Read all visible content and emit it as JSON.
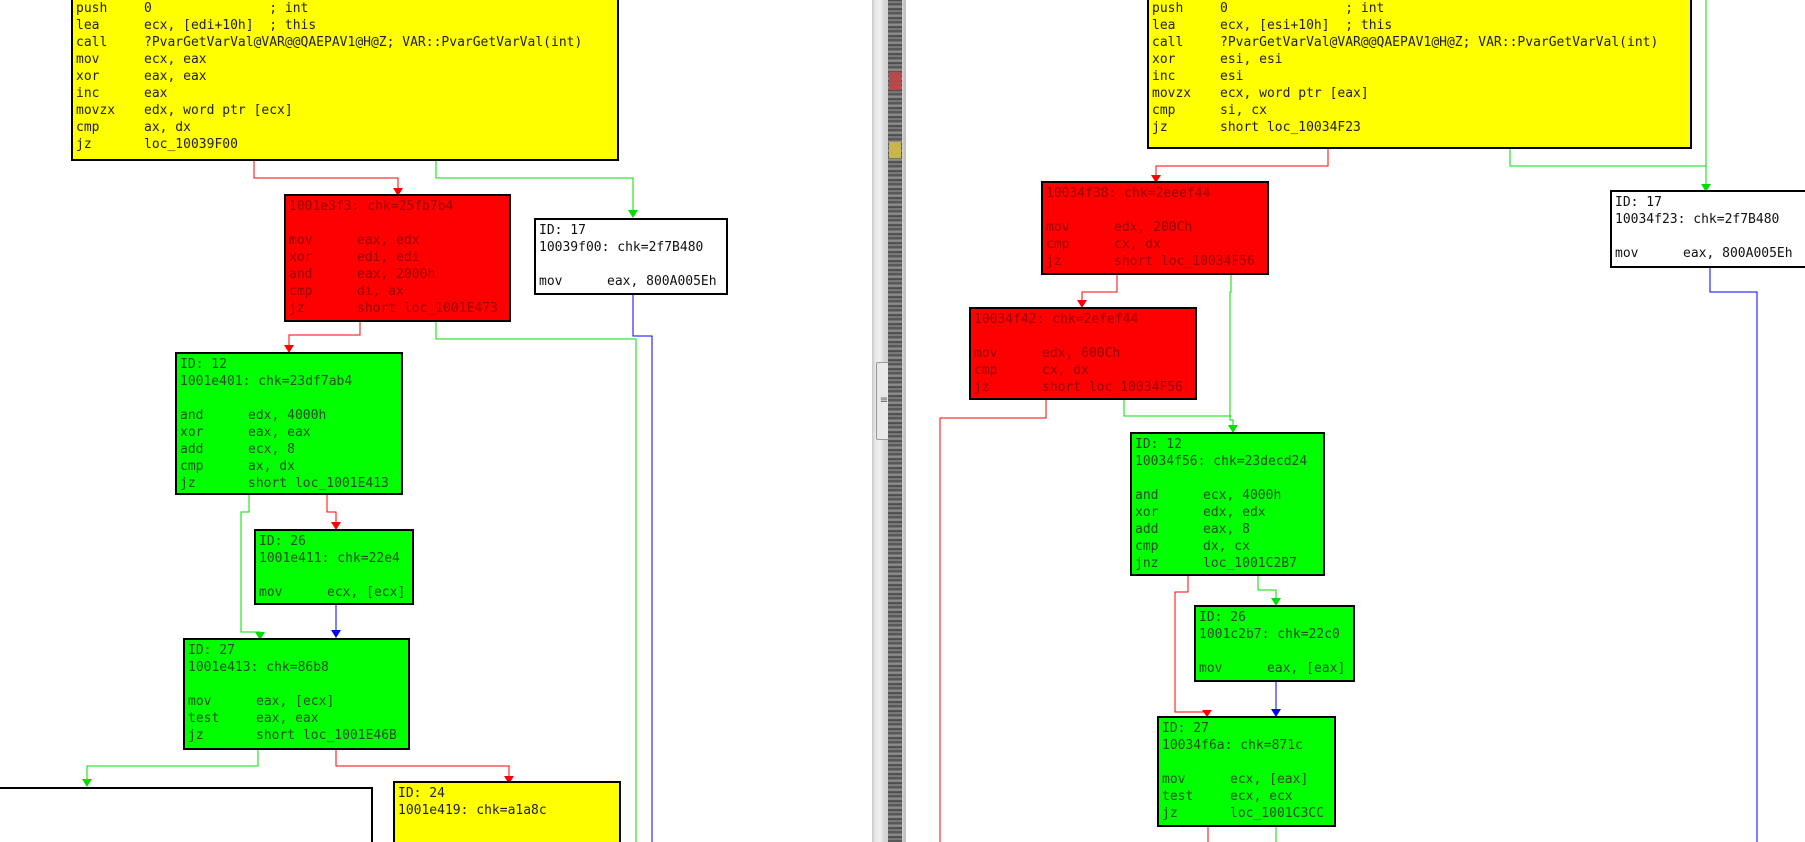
{
  "left_pane": {
    "nodes": [
      {
        "name": "block-left-top",
        "color": "yellow",
        "header": [],
        "instructions": [
          [
            "push",
            "0               ; int"
          ],
          [
            "lea",
            "ecx, [edi+10h]  ; this"
          ],
          [
            "call",
            "?PvarGetVarVal@VAR@@QAEPAV1@H@Z; VAR::PvarGetVarVal(int)"
          ],
          [
            "mov",
            "ecx, eax"
          ],
          [
            "xor",
            "eax, eax"
          ],
          [
            "inc",
            "eax"
          ],
          [
            "movzx",
            "edx, word ptr [ecx]"
          ],
          [
            "cmp",
            "ax, dx"
          ],
          [
            "jz",
            "loc_10039F00"
          ]
        ]
      },
      {
        "name": "block-left-1001e3f3",
        "color": "red",
        "header": [
          "1001e3f3: chk=25fb7b4"
        ],
        "instructions": [
          [
            "mov",
            "eax, edx"
          ],
          [
            "xor",
            "edi, edi"
          ],
          [
            "and",
            "eax, 2000h"
          ],
          [
            "cmp",
            "di, ax"
          ],
          [
            "jz",
            "short loc_1001E473"
          ]
        ]
      },
      {
        "name": "block-left-10039f00",
        "color": "white",
        "header": [
          "ID: 17",
          "10039f00: chk=2f7B480"
        ],
        "instructions": [
          [
            "mov",
            "eax, 800A005Eh"
          ]
        ]
      },
      {
        "name": "block-left-1001e401",
        "color": "green",
        "header": [
          "ID: 12",
          "1001e401: chk=23df7ab4"
        ],
        "instructions": [
          [
            "and",
            "edx, 4000h"
          ],
          [
            "xor",
            "eax, eax"
          ],
          [
            "add",
            "ecx, 8"
          ],
          [
            "cmp",
            "ax, dx"
          ],
          [
            "jz",
            "short loc_1001E413"
          ]
        ]
      },
      {
        "name": "block-left-1001e411",
        "color": "green",
        "header": [
          "ID: 26",
          "1001e411: chk=22e4"
        ],
        "instructions": [
          [
            "mov",
            "ecx, [ecx]"
          ]
        ]
      },
      {
        "name": "block-left-1001e413",
        "color": "green",
        "header": [
          "ID: 27",
          "1001e413: chk=86b8"
        ],
        "instructions": [
          [
            "mov",
            "eax, [ecx]"
          ],
          [
            "test",
            "eax, eax"
          ],
          [
            "jz",
            "short loc_1001E46B"
          ]
        ]
      },
      {
        "name": "block-left-bottom-white",
        "color": "white",
        "header": [],
        "instructions": []
      },
      {
        "name": "block-left-1001e419",
        "color": "yellow",
        "header": [
          "ID: 24",
          "1001e419: chk=a1a8c"
        ],
        "instructions": []
      }
    ]
  },
  "right_pane": {
    "nodes": [
      {
        "name": "block-right-top",
        "color": "yellow",
        "header": [],
        "instructions": [
          [
            "push",
            "0               ; int"
          ],
          [
            "lea",
            "ecx, [esi+10h]  ; this"
          ],
          [
            "call",
            "?PvarGetVarVal@VAR@@QAEPAV1@H@Z; VAR::PvarGetVarVal(int)"
          ],
          [
            "xor",
            "esi, esi"
          ],
          [
            "inc",
            "esi"
          ],
          [
            "movzx",
            "ecx, word ptr [eax]"
          ],
          [
            "cmp",
            "si, cx"
          ],
          [
            "jz",
            "short loc_10034F23"
          ]
        ]
      },
      {
        "name": "block-right-10034f38",
        "color": "red",
        "header": [
          "10034f38: chk=2eeef44"
        ],
        "instructions": [
          [
            "mov",
            "edx, 200Ch"
          ],
          [
            "cmp",
            "cx, dx"
          ],
          [
            "jz",
            "short loc_10034F56"
          ]
        ]
      },
      {
        "name": "block-right-10034f23",
        "color": "white",
        "header": [
          "ID: 17",
          "10034f23: chk=2f7B480"
        ],
        "instructions": [
          [
            "mov",
            "eax, 800A005Eh"
          ]
        ]
      },
      {
        "name": "block-right-10034f42",
        "color": "red",
        "header": [
          "10034f42: chk=2efef44"
        ],
        "instructions": [
          [
            "mov",
            "edx, 600Ch"
          ],
          [
            "cmp",
            "cx, dx"
          ],
          [
            "jz",
            "short loc_10034F56"
          ]
        ]
      },
      {
        "name": "block-right-10034f56",
        "color": "green",
        "header": [
          "ID: 12",
          "10034f56: chk=23decd24"
        ],
        "instructions": [
          [
            "and",
            "ecx, 4000h"
          ],
          [
            "xor",
            "edx, edx"
          ],
          [
            "add",
            "eax, 8"
          ],
          [
            "cmp",
            "dx, cx"
          ],
          [
            "jnz",
            "loc_1001C2B7"
          ]
        ]
      },
      {
        "name": "block-right-1001c2b7",
        "color": "green",
        "header": [
          "ID: 26",
          "1001c2b7: chk=22c0"
        ],
        "instructions": [
          [
            "mov",
            "eax, [eax]"
          ]
        ]
      },
      {
        "name": "block-right-10034f6a",
        "color": "green",
        "header": [
          "ID: 27",
          "10034f6a: chk=871c"
        ],
        "instructions": [
          [
            "mov",
            "ecx, [eax]"
          ],
          [
            "test",
            "ecx, ecx"
          ],
          [
            "jz",
            "loc_1001C3CC"
          ]
        ]
      }
    ]
  },
  "colors": {
    "yellow": "#ffff00",
    "red": "#ff0000",
    "green": "#00ff00",
    "edge_true": "#00dd00",
    "edge_false": "#ff0000",
    "edge_uncond": "#0000ff"
  }
}
